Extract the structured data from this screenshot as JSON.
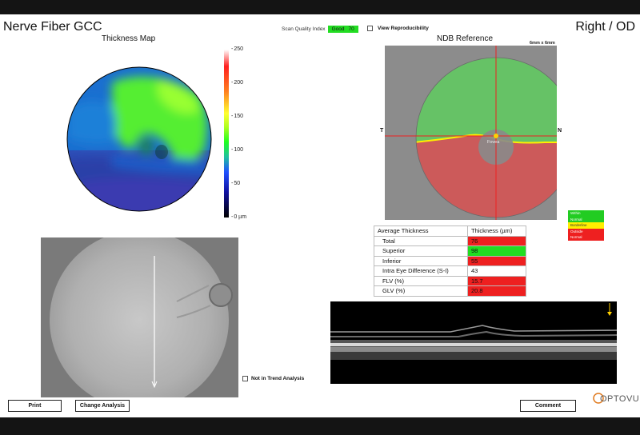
{
  "header": {
    "title": "Nerve Fiber GCC",
    "eye": "Right / OD",
    "scan_quality_label": "Scan Quality Index",
    "scan_quality_status": "Good",
    "scan_quality_value": "70",
    "view_reproducibility_label": "View Reproducibility"
  },
  "thickness_map": {
    "title": "Thickness Map",
    "scale_labels": [
      "250",
      "200",
      "150",
      "100",
      "50",
      "0 µm"
    ]
  },
  "ndb": {
    "title": "NDB Reference",
    "size_label": "6mm x 6mm",
    "temporal_label": "T",
    "nasal_label": "N",
    "fovea_label": "Fovea"
  },
  "legend": {
    "items": [
      {
        "label": "Within",
        "color": "#22cc22"
      },
      {
        "label": "Normal",
        "color": "#22cc22"
      },
      {
        "label": "Borderline",
        "color": "#ffee00"
      },
      {
        "label": "Outside",
        "color": "#ee2020"
      },
      {
        "label": "Normal",
        "color": "#ee2020"
      }
    ]
  },
  "table": {
    "headers": [
      "Average Thickness",
      "Thickness (µm)"
    ],
    "rows": [
      {
        "label": "Total",
        "value": "76",
        "color": "#ee2020"
      },
      {
        "label": "Superior",
        "value": "98",
        "color": "#22dd22"
      },
      {
        "label": "Inferior",
        "value": "55",
        "color": "#ee2020"
      },
      {
        "label": "Intra Eye Difference (S-I)",
        "value": "43",
        "color": "#ffffff"
      },
      {
        "label": "FLV (%)",
        "value": "15.7",
        "color": "#ee2020"
      },
      {
        "label": "GLV (%)",
        "value": "20.8",
        "color": "#ee2020"
      }
    ]
  },
  "trend": {
    "not_in_trend_label": "Not in Trend Analysis"
  },
  "buttons": {
    "print": "Print",
    "change_analysis": "Change Analysis",
    "comment": "Comment"
  },
  "logo": {
    "text": "OPTOVUE"
  },
  "colors": {
    "good_badge": "#22dd22",
    "red": "#ee2020",
    "green": "#22dd22",
    "crosshair": "#ee2020",
    "fovea_dot": "#ffd000"
  }
}
